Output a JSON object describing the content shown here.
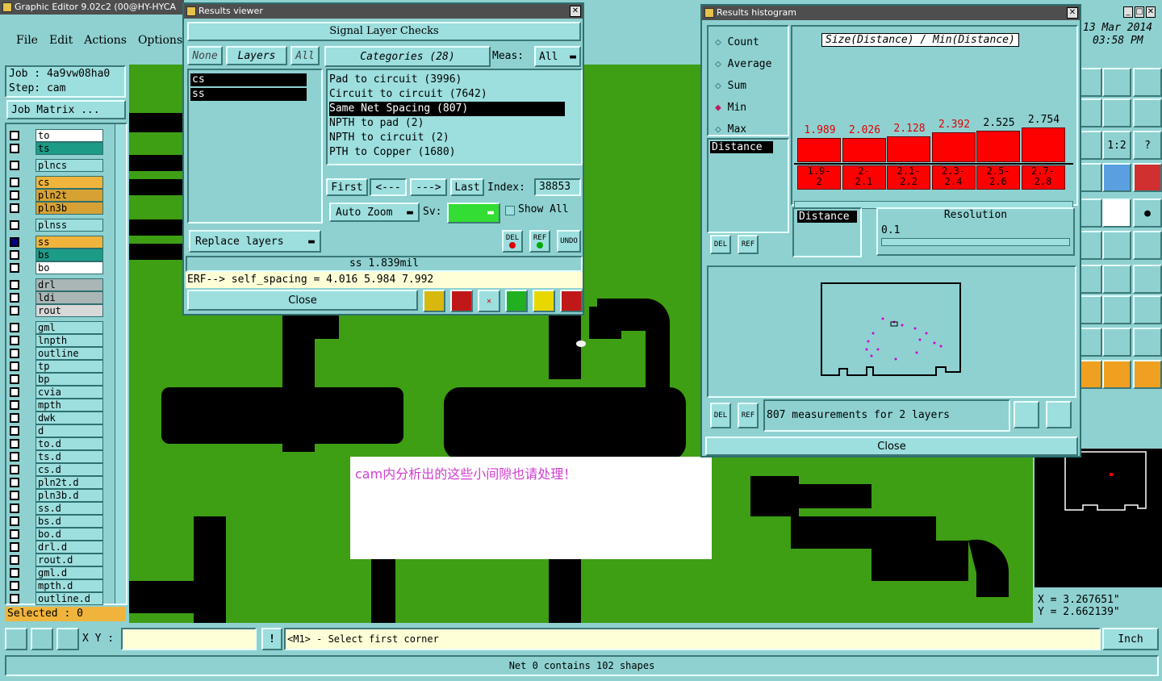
{
  "main_title": "Graphic Editor 9.02c2 (00@HY-HYCA",
  "menu": [
    "File",
    "Edit",
    "Actions",
    "Options"
  ],
  "job": {
    "job_label": "Job : 4a9vw08ha0",
    "step_label": "Step: cam",
    "matrix_button": "Job Matrix ..."
  },
  "layers": [
    {
      "name": "to",
      "color": "#ffffff"
    },
    {
      "name": "ts",
      "color": "#1c9b86"
    },
    {
      "name": "plncs",
      "color": "#9ddede"
    },
    {
      "name": "cs",
      "color": "#f0b43c"
    },
    {
      "name": "pln2t",
      "color": "#d7a233"
    },
    {
      "name": "pln3b",
      "color": "#d7a233"
    },
    {
      "name": "plnss",
      "color": "#9ddede"
    },
    {
      "name": "ss",
      "color": "#f0b43c"
    },
    {
      "name": "bs",
      "color": "#1c9b86"
    },
    {
      "name": "bo",
      "color": "#ffffff"
    },
    {
      "name": "drl",
      "color": "#aab5b5"
    },
    {
      "name": "ldi",
      "color": "#aab5b5"
    },
    {
      "name": "rout",
      "color": "#d8d8d8"
    },
    {
      "name": "gml",
      "color": "#9ddede"
    },
    {
      "name": "lnpth",
      "color": "#9ddede"
    },
    {
      "name": "outline",
      "color": "#9ddede"
    },
    {
      "name": "tp",
      "color": "#9ddede"
    },
    {
      "name": "bp",
      "color": "#9ddede"
    },
    {
      "name": "cvia",
      "color": "#9ddede"
    },
    {
      "name": "mpth",
      "color": "#9ddede"
    },
    {
      "name": "dwk",
      "color": "#9ddede"
    },
    {
      "name": "d",
      "color": "#9ddede"
    },
    {
      "name": "to.d",
      "color": "#9ddede"
    },
    {
      "name": "ts.d",
      "color": "#9ddede"
    },
    {
      "name": "cs.d",
      "color": "#9ddede"
    },
    {
      "name": "pln2t.d",
      "color": "#9ddede"
    },
    {
      "name": "pln3b.d",
      "color": "#9ddede"
    },
    {
      "name": "ss.d",
      "color": "#9ddede"
    },
    {
      "name": "bs.d",
      "color": "#9ddede"
    },
    {
      "name": "bo.d",
      "color": "#9ddede"
    },
    {
      "name": "drl.d",
      "color": "#9ddede"
    },
    {
      "name": "rout.d",
      "color": "#9ddede"
    },
    {
      "name": "gml.d",
      "color": "#9ddede"
    },
    {
      "name": "mpth.d",
      "color": "#9ddede"
    },
    {
      "name": "outline.d",
      "color": "#9ddede"
    }
  ],
  "selected": "Selected : 0",
  "date": "13 Mar 2014",
  "time": "03:58 PM",
  "results_viewer": {
    "title": "Results viewer",
    "header": "Signal Layer Checks",
    "none": "None",
    "layers": "Layers",
    "all": "All",
    "categories_label": "Categories (28)",
    "meas_label": "Meas:",
    "meas_value": "All",
    "layer_items": [
      "cs",
      "ss"
    ],
    "categories": [
      "Pad to circuit (3996)",
      "Circuit to circuit (7642)",
      "Same Net Spacing (807)",
      "NPTH to pad (2)",
      "NPTH to circuit (2)",
      "PTH to Copper (1680)"
    ],
    "first": "First",
    "prev": "<---",
    "next": "--->",
    "last": "Last",
    "index_label": "Index:",
    "index_value": "38853",
    "auto_zoom": "Auto Zoom",
    "sv_label": "Sv:",
    "show_all": "Show All",
    "replace_layers": "Replace layers",
    "del": "DEL",
    "ref": "REF",
    "undo": "UNDO",
    "status": "ss 1.839mil",
    "erf": "ERF--> self_spacing = 4.016 5.984 7.992",
    "close": "Close"
  },
  "histogram": {
    "title": "Results histogram",
    "options": [
      "Count",
      "Average",
      "Sum",
      "Min",
      "Max"
    ],
    "selected_option": "Min",
    "chart_title": "Size(Distance) / Min(Distance)",
    "distance_list": [
      "Distance"
    ],
    "distance_label": "Distance",
    "resolution_label": "Resolution",
    "resolution_value": "0.1",
    "summary": "807 measurements for 2 layers",
    "close": "Close",
    "del": "DEL",
    "ref": "REF"
  },
  "chart_data": {
    "type": "bar",
    "title": "Size(Distance) / Min(Distance)",
    "categories": [
      "1.9-2",
      "2-2.1",
      "2.1-2.2",
      "2.3-2.4",
      "2.5-2.6",
      "2.7-2.8"
    ],
    "category_top": [
      "1.9-",
      "2-",
      "2.1-",
      "2.3-",
      "2.5-",
      "2.7-"
    ],
    "category_bottom": [
      "2",
      "2.1",
      "2.2",
      "2.4",
      "2.6",
      "2.8"
    ],
    "values": [
      1.989,
      2.026,
      2.128,
      2.392,
      2.525,
      2.754
    ],
    "value_labels": [
      "1.989",
      "2.026",
      "2.128",
      "2.392",
      "2.525",
      "2.754"
    ],
    "value_colors": [
      "#e00000",
      "#e00000",
      "#e00000",
      "#e00000",
      "#000000",
      "#000000"
    ],
    "bar_color": "#ff0000"
  },
  "annotation": "cam内分析出的这些小间隙也请处理！",
  "coords": {
    "x": "X = 3.267651\"",
    "y": "Y = 2.662139\""
  },
  "command": {
    "xy_label": "X Y :",
    "xy_value": "",
    "prompt": "<M1> - Select first corner",
    "unit": "Inch"
  },
  "status_bar": "Net 0 contains 102 shapes"
}
